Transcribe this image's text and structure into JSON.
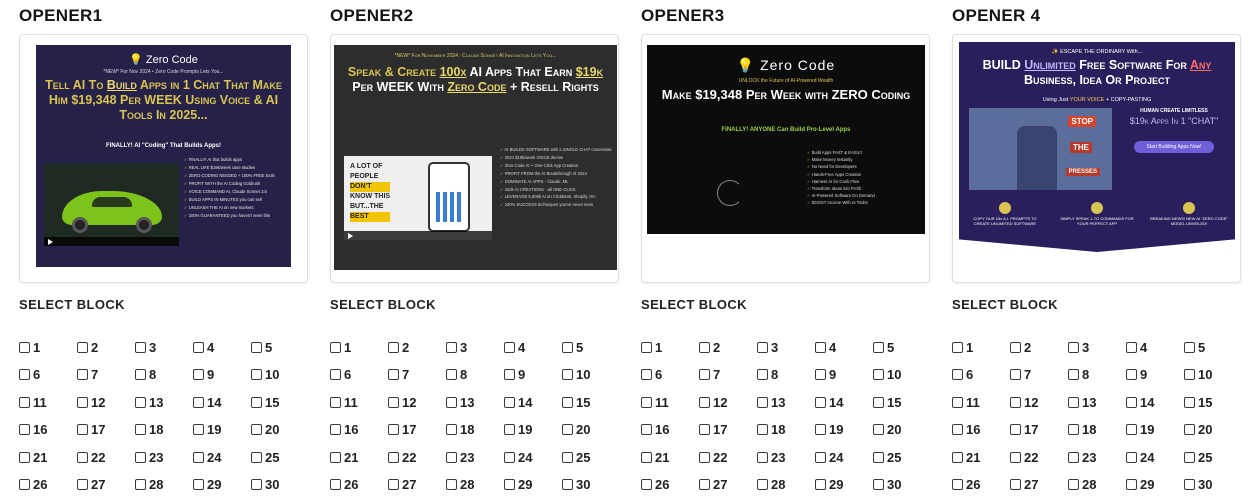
{
  "openers": [
    {
      "title": "OPENER1",
      "select_label": "SELECT BLOCK",
      "preview": {
        "logo": "Zero Code",
        "subtitle": "*NEW* For Nov 2024 • Zero Code Prompts Lets You...",
        "headline_pre": "Tell AI To ",
        "headline_link": "Build",
        "headline_post": " Apps in 1 Chat That Make Him $19,348 Per WEEK Using Voice & AI Tools In 2025...",
        "tagline": "FINALLY! AI \"Coding\" That Builds Apps!",
        "bullets": [
          "FINALLY! AI that builds apps",
          "REAL LIFE $19k/week case studies",
          "ZERO CODING NEEDED + 100% FREE tools",
          "PROFIT WITH the AI Coding Goldrush",
          "VOICE COMMAND AI, Claude Sonnet 3.5",
          "BUILD APPS IN MINUTES you can sell",
          "UNLEASH THE AI on new markets",
          "100% GUARANTEED you haven't seen this"
        ]
      }
    },
    {
      "title": "OPENER2",
      "select_label": "SELECT BLOCK",
      "preview": {
        "top": "*NEW* For November 2024 : Claude Sonnet AI Innovation Lets You...",
        "headline_a": "Speak & Create ",
        "headline_b": "100x",
        "headline_c": " AI Apps That Earn ",
        "headline_d": "$19k",
        "headline_e": " Per WEEK With ",
        "headline_f": "Zero Code",
        "headline_g": " + Resell Rights",
        "video_text": [
          "A LOT OF",
          "PEOPLE",
          "DON'T",
          "KNOW THIS",
          "BUT...THE",
          "BEST"
        ],
        "bullets": [
          "AI BUILDS SOFTWARE with a SINGLE CHAT conversation",
          "2024 $19k/week VOICE demos",
          "Zero-Code AI + One-Click App Creation",
          "PROFIT FROM the AI Breakthrough of 2024",
          "DOMINATE AI APPS - Claude, ML",
          "10ds AI CREATIONS - all ONE-CLICK",
          "LEVERAGE 5,000k AI on Clickbank, Shopify, IG+",
          "100% SUCCESS techniques you've never seen"
        ]
      }
    },
    {
      "title": "OPENER3",
      "select_label": "SELECT BLOCK",
      "preview": {
        "logo": "Zero Code",
        "subtitle": "UNLOCK the Future of AI-Powered Wealth",
        "headline": "Make $19,348 Per Week with ZERO Coding",
        "tagline": "FINALLY! ANYONE Can Build Pro-Level Apps",
        "bullets": [
          "Build Apps FAST & EASILY",
          "Make Money Instantly",
          "No Need for Developers",
          "Hands-Free Apps Creation",
          "Harness AI for Cash Flow",
          "Transform Ideas into Profit",
          "AI-Powered Software On Demand",
          "BOOST Income With AI Tools!"
        ]
      }
    },
    {
      "title": "OPENER 4",
      "select_label": "SELECT BLOCK",
      "preview": {
        "escape": "ESCAPE THE ORDINARY With...",
        "headline_a": "BUILD ",
        "headline_b": "Unlimited",
        "headline_c": " Free Software For ",
        "headline_d": "Any",
        "headline_e": " Business, Idea Or Project",
        "voice_pre": "Using Just ",
        "voice_y": "YOUR VOICE",
        "voice_post": " + COPY-PASTING",
        "video_stop": "STOP",
        "video_the": "THE",
        "video_presses": "PRESSES",
        "right_head": "HUMAN CREATE LIMITLESS",
        "right_big": "$19k Apps In 1 \"CHAT\"",
        "button": "Start Building Apps Now!",
        "features": [
          "COPY OUR 15x A.I. PROMPTS TO CREATE UNLIMITED SOFTWARE",
          "SIMPLY SPEAK 1-TO COMMANDS FOR YOUR PERFECT APP",
          "BREAKING NEWS! NEW AI \"ZERO CODE\" MODEL UNVEILED!"
        ]
      }
    }
  ],
  "checkbox_numbers": [
    1,
    2,
    3,
    4,
    5,
    6,
    7,
    8,
    9,
    10,
    11,
    12,
    13,
    14,
    15,
    16,
    17,
    18,
    19,
    20,
    21,
    22,
    23,
    24,
    25,
    26,
    27,
    28,
    29,
    30
  ]
}
